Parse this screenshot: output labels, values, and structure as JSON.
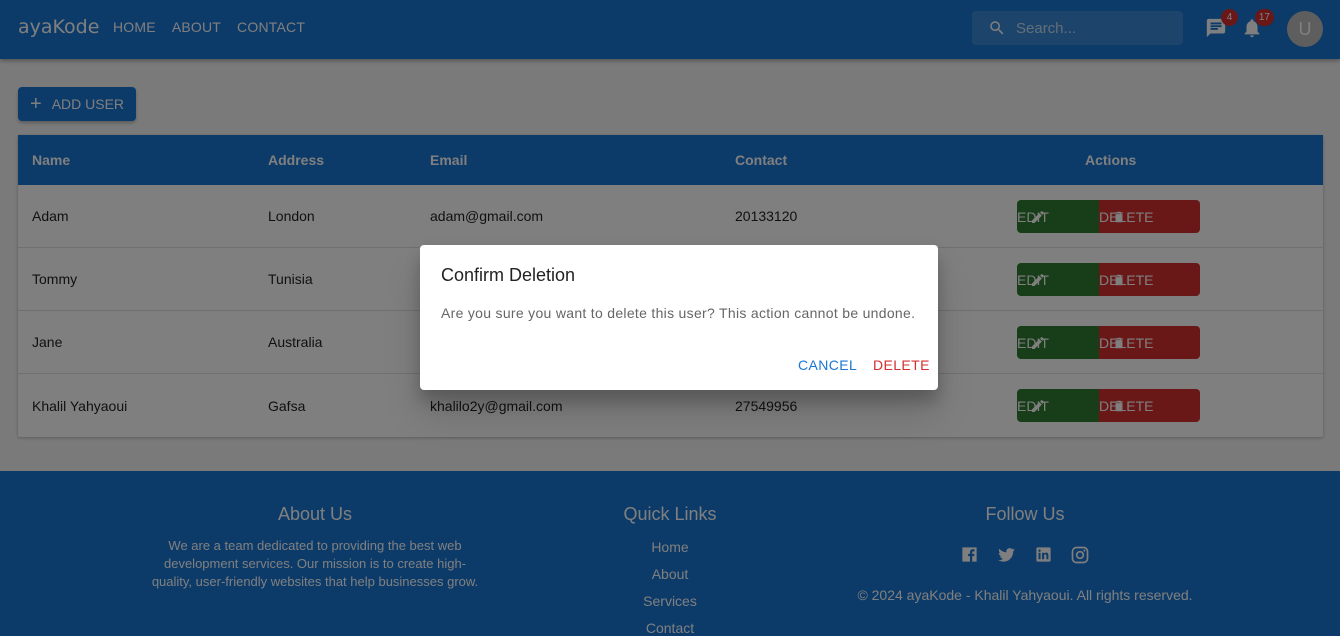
{
  "header": {
    "brand": "ayaKode",
    "nav": [
      "HOME",
      "ABOUT",
      "CONTACT"
    ],
    "search_placeholder": "Search...",
    "messages_count": "4",
    "notifications_count": "17",
    "avatar_letter": "U"
  },
  "toolbar": {
    "add_user_label": "ADD USER"
  },
  "table": {
    "columns": [
      "Name",
      "Address",
      "Email",
      "Contact",
      "Actions"
    ],
    "rows": [
      {
        "name": "Adam",
        "address": "London",
        "email": "adam@gmail.com",
        "contact": "20133120"
      },
      {
        "name": "Tommy",
        "address": "Tunisia",
        "email": "",
        "contact": ""
      },
      {
        "name": "Jane",
        "address": "Australia",
        "email": "",
        "contact": ""
      },
      {
        "name": "Khalil Yahyaoui",
        "address": "Gafsa",
        "email": "khalilo2y@gmail.com",
        "contact": "27549956"
      }
    ],
    "edit_label": "EDIT",
    "delete_label": "DELETE"
  },
  "footer": {
    "about_title": "About Us",
    "about_text": "We are a team dedicated to providing the best web development services. Our mission is to create high-quality, user-friendly websites that help businesses grow.",
    "links_title": "Quick Links",
    "links": [
      "Home",
      "About",
      "Services",
      "Contact"
    ],
    "follow_title": "Follow Us",
    "social": [
      "facebook-icon",
      "twitter-icon",
      "linkedin-icon",
      "instagram-icon"
    ],
    "copyright": "© 2024 ayaKode - Khalil Yahyaoui. All rights reserved."
  },
  "dialog": {
    "title": "Confirm Deletion",
    "message": "Are you sure you want to delete this user? This action cannot be undone.",
    "cancel_label": "CANCEL",
    "confirm_label": "DELETE"
  },
  "colors": {
    "primary": "#1976d2",
    "success": "#2e7d32",
    "error": "#d32f2f"
  }
}
